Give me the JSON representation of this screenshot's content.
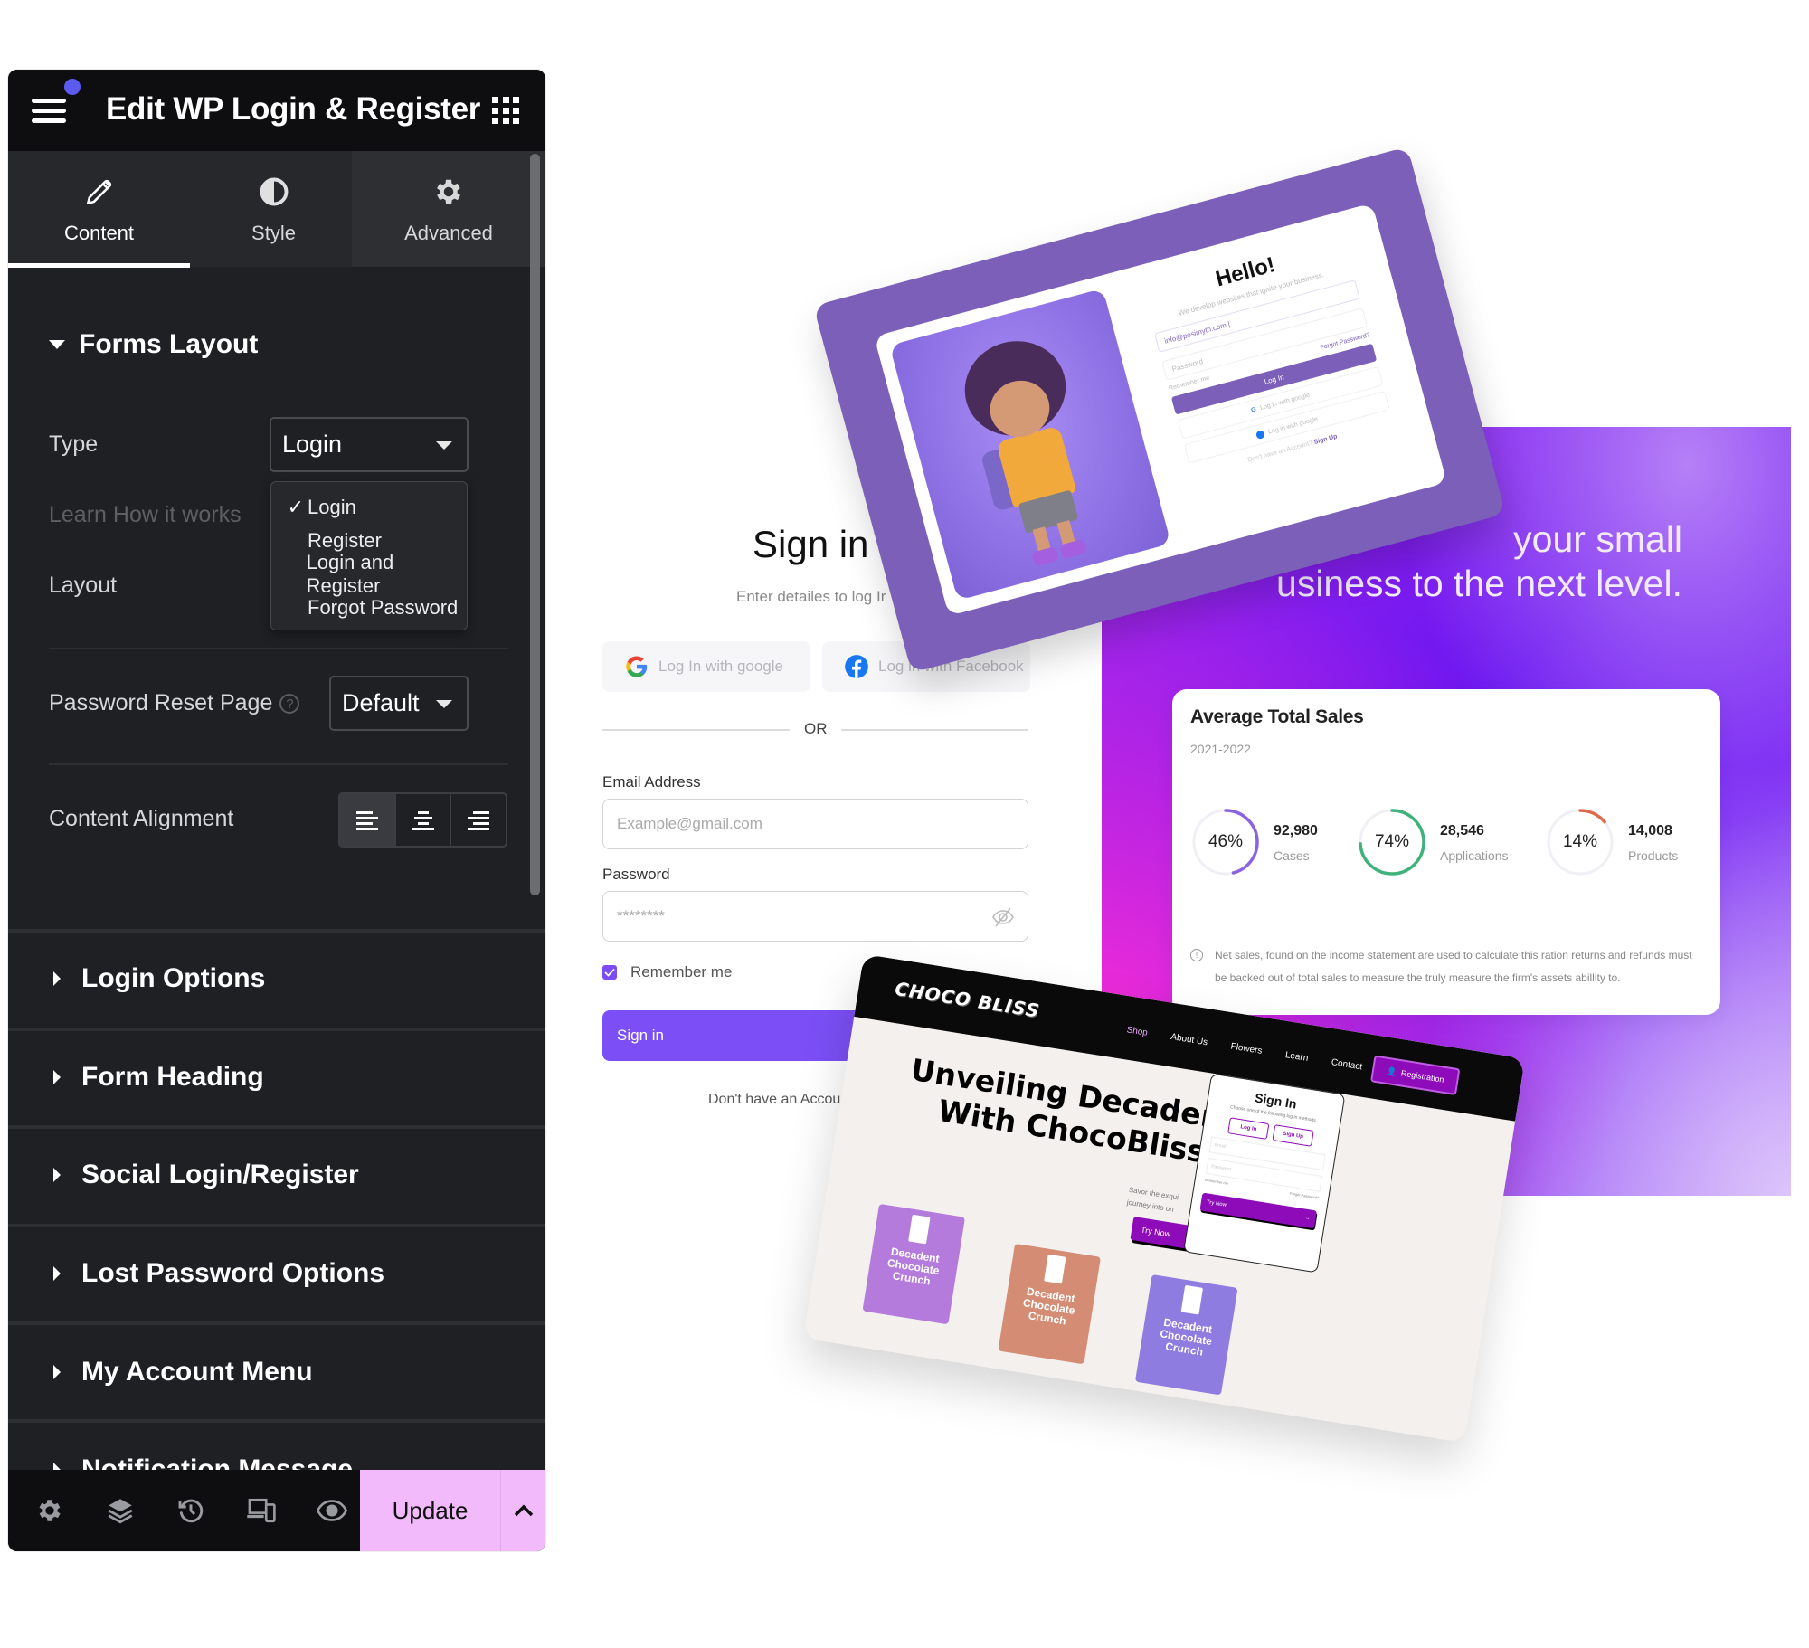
{
  "editor": {
    "title": "Edit WP Login & Register",
    "tabs": [
      {
        "label": "Content",
        "icon": "pencil-icon",
        "active": true
      },
      {
        "label": "Style",
        "icon": "half-circle-icon",
        "active": false
      },
      {
        "label": "Advanced",
        "icon": "gear-icon",
        "active": false
      }
    ],
    "forms_layout": {
      "title": "Forms Layout",
      "type_label": "Type",
      "type_value": "Login",
      "type_options": [
        "Login",
        "Register",
        "Login and Register",
        "Forgot Password"
      ],
      "type_checkmark": "✓",
      "learn_link": "Learn How it works",
      "layout_label": "Layout",
      "password_reset_label": "Password Reset Page",
      "password_reset_help": "?",
      "password_reset_value": "Default",
      "content_alignment_label": "Content Alignment",
      "alignment_options": [
        "left",
        "center",
        "right"
      ],
      "alignment_selected": "left"
    },
    "sections": [
      "Login Options",
      "Form Heading",
      "Social Login/Register",
      "Lost Password Options",
      "My Account Menu",
      "Notification Message"
    ],
    "bottom_bar": {
      "icons": [
        "settings-icon",
        "layers-icon",
        "history-icon",
        "responsive-icon",
        "preview-eye-icon"
      ],
      "update_label": "Update",
      "colors": {
        "update_bg": "#f2bafa"
      }
    }
  },
  "signin_form": {
    "title": "Sign in",
    "subtitle": "Enter detailes to log Ir",
    "google_btn": "Log In with google",
    "facebook_btn": "Log in with Facebook",
    "or": "OR",
    "email_label": "Email Address",
    "email_placeholder": "Example@gmail.com",
    "password_label": "Password",
    "password_placeholder": "********",
    "remember_me": "Remember me",
    "signin_btn": "Sign in",
    "no_account": "Don't have an Accou",
    "colors": {
      "accent": "#7b4ff5"
    }
  },
  "promo": {
    "headline_line1": "your small",
    "headline_line2": "usiness to the next level."
  },
  "sales_card": {
    "title": "Average Total Sales",
    "period": "2021-2022",
    "stats": [
      {
        "percent": "46%",
        "fraction": 0.46,
        "value": "92,980",
        "label": "Cases",
        "color": "#8a63e0"
      },
      {
        "percent": "74%",
        "fraction": 0.74,
        "value": "28,546",
        "label": "Applications",
        "color": "#3eb27a"
      },
      {
        "percent": "14%",
        "fraction": 0.14,
        "value": "14,008",
        "label": "Products",
        "color": "#e06a4e"
      }
    ],
    "note": "Net sales, found on the income statement are used to calculate this ration returns and refunds must be backed out of total sales to measure the truly measure the firm's assets abillity to."
  },
  "hello_card": {
    "title": "Hello!",
    "subtitle": "We develop websites that ignite your business.",
    "email_value": "info@posimyth.com |",
    "password_placeholder": "Password",
    "remember": "Remember me",
    "forgot": "Forgot Password?",
    "login_btn": "Log In",
    "google_btn": "Log in with google",
    "facebook_btn": "Log in with google",
    "footer_text": "Don't have an Account?",
    "footer_link": "Sign Up"
  },
  "choco_card": {
    "logo": "CHOCO BLISS",
    "nav": [
      "Shop",
      "About Us",
      "Flowers",
      "Learn",
      "Contact"
    ],
    "registration_btn": "Registration",
    "hero_line1": "Unveiling Decadent Ple",
    "hero_line2": "With ChocoBliss De",
    "savor_text_line1": "Savor the exqui",
    "savor_text_line2": "journey into un",
    "try_now": "Try Now",
    "snack_label": "Decadent Chocolate Crunch",
    "popup": {
      "title": "Sign In",
      "subtitle": "Choose one of the following log in methods.",
      "login_tab": "Log In",
      "signup_tab": "Sign Up",
      "email_placeholder": "Email",
      "password_placeholder": "Password",
      "remember": "Remember me",
      "forgot": "Forgot Password?",
      "try_now": "Try Now"
    }
  }
}
